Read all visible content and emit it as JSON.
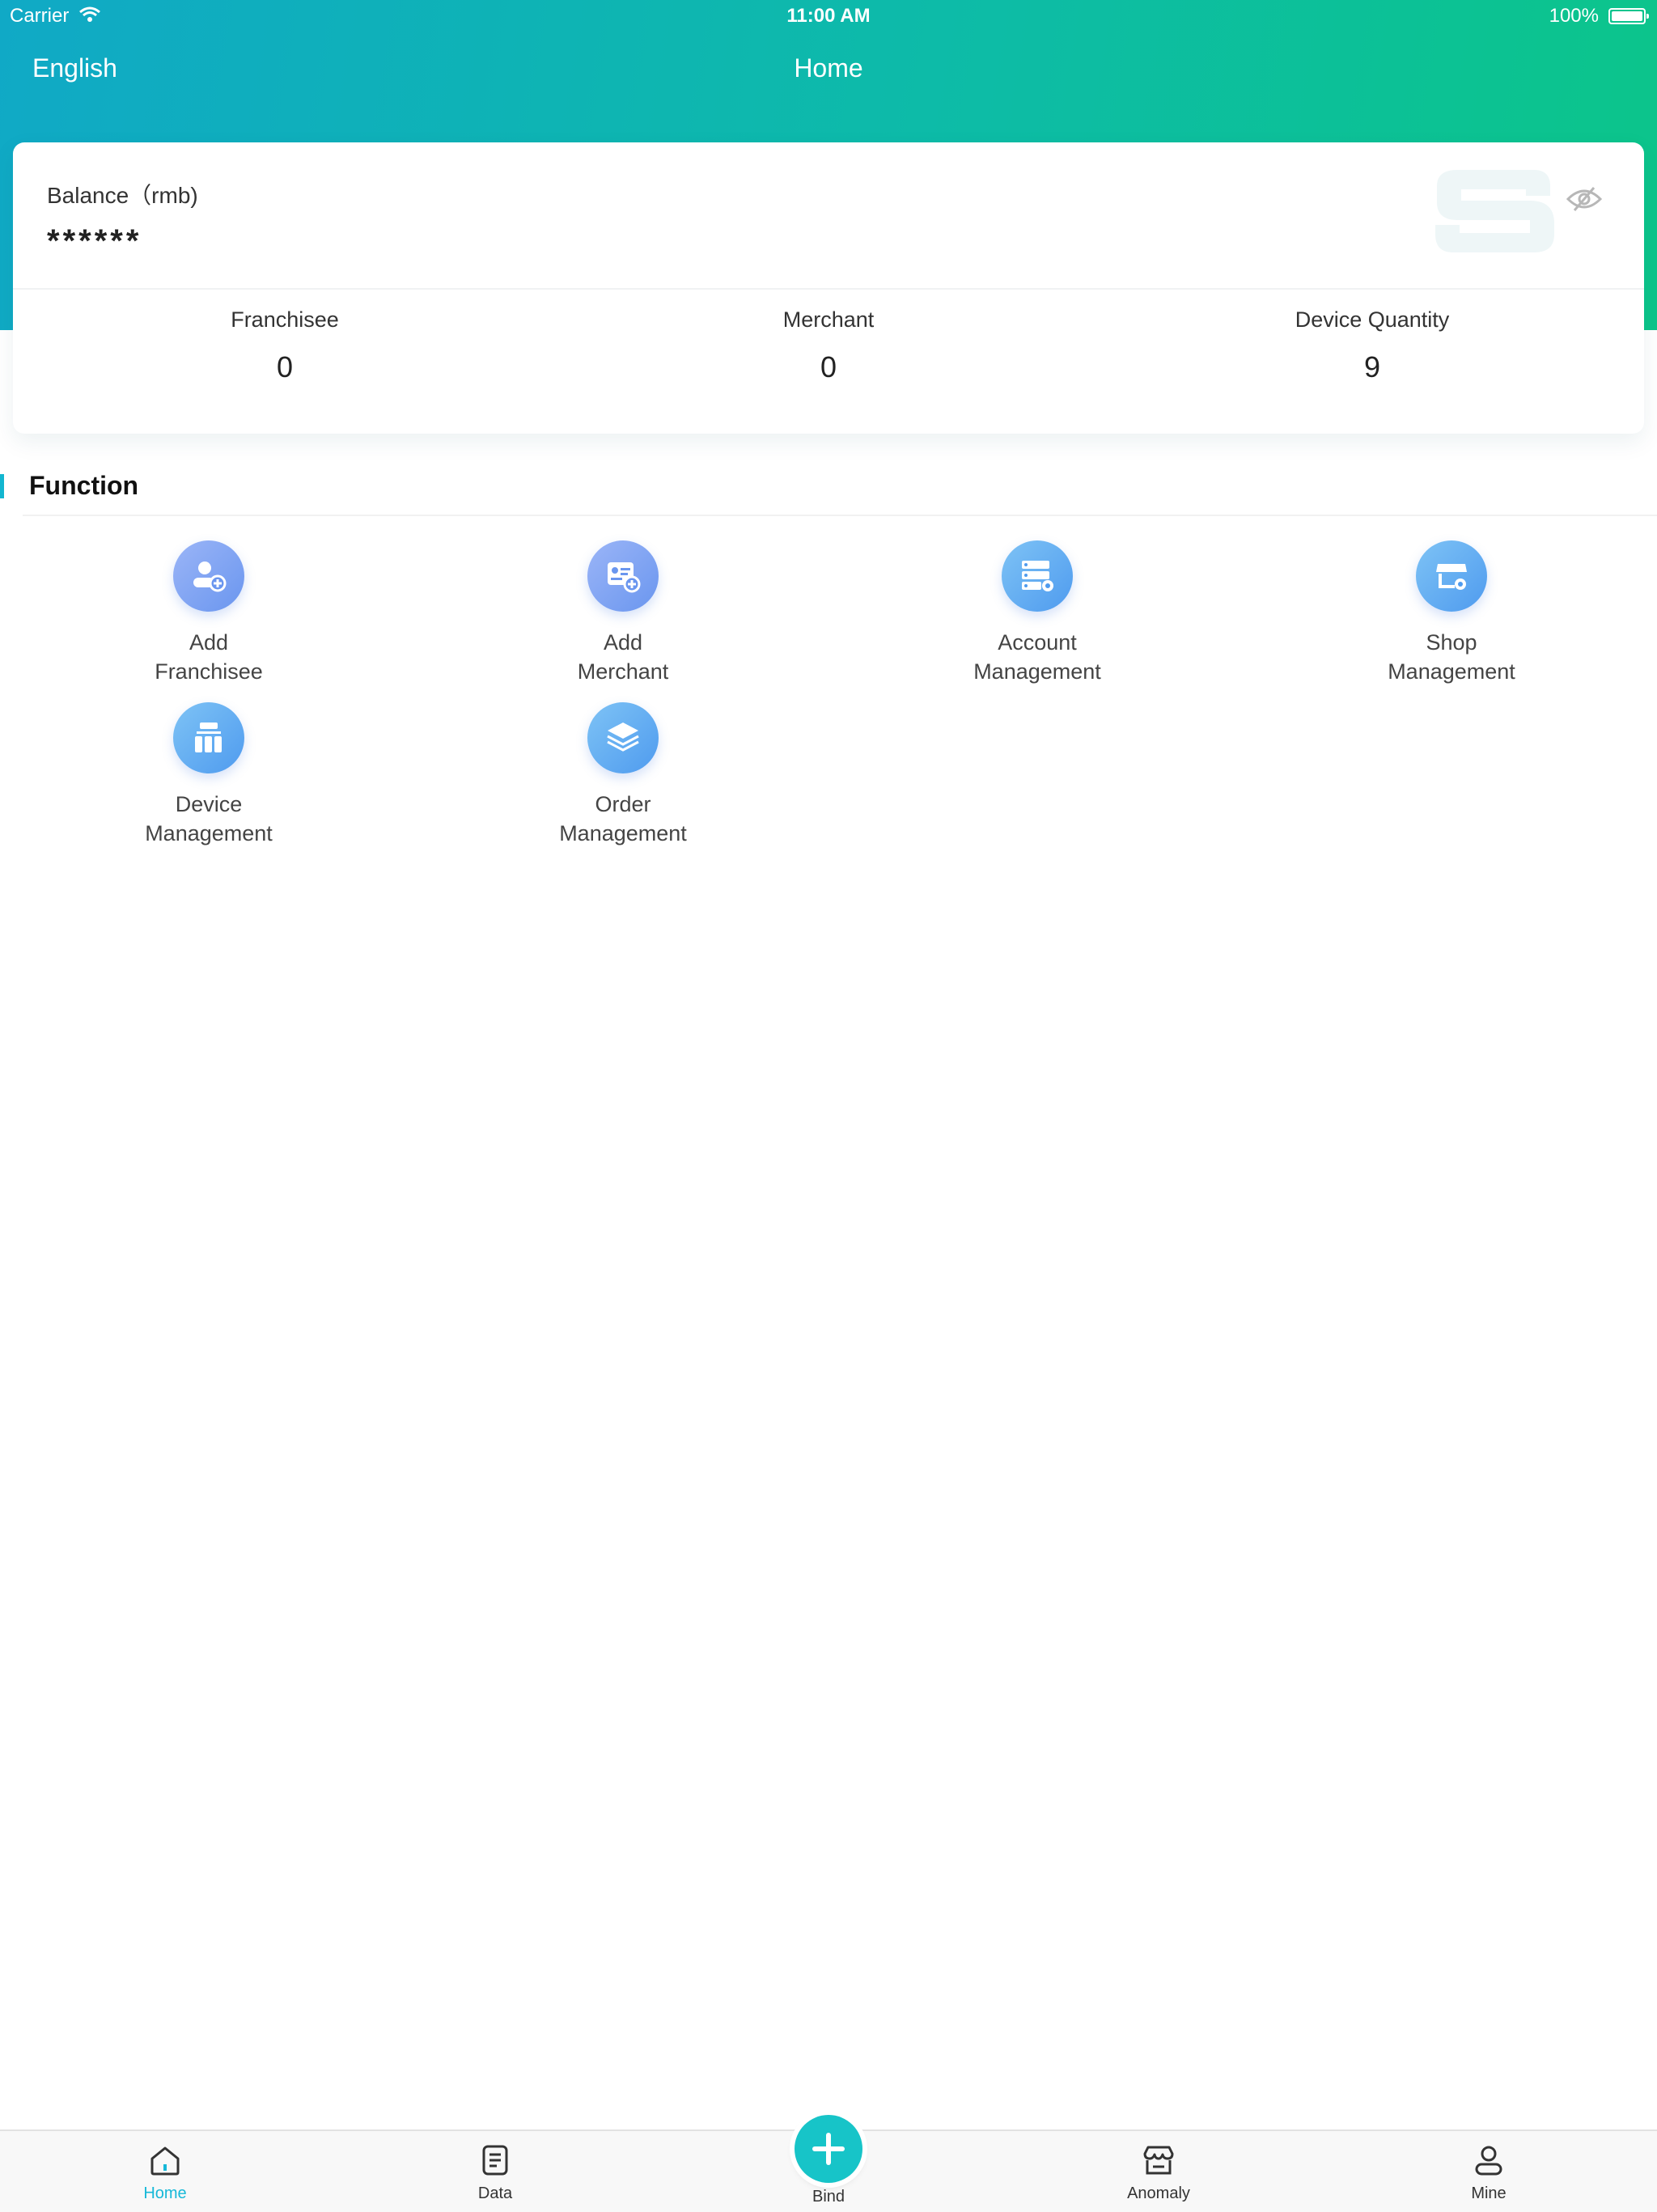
{
  "status_bar": {
    "carrier": "Carrier",
    "time": "11:00 AM",
    "battery": "100%"
  },
  "nav": {
    "language": "English",
    "title": "Home"
  },
  "balance": {
    "label": "Balance（rmb)",
    "value": "******"
  },
  "stats": [
    {
      "label": "Franchisee",
      "value": "0"
    },
    {
      "label": "Merchant",
      "value": "0"
    },
    {
      "label": "Device Quantity",
      "value": "9"
    }
  ],
  "section": {
    "title": "Function"
  },
  "functions": [
    {
      "line1": "Add",
      "line2": "Franchisee",
      "icon": "add-franchisee-icon"
    },
    {
      "line1": "Add",
      "line2": "Merchant",
      "icon": "add-merchant-icon"
    },
    {
      "line1": "Account",
      "line2": "Management",
      "icon": "account-management-icon"
    },
    {
      "line1": "Shop",
      "line2": "Management",
      "icon": "shop-management-icon"
    },
    {
      "line1": "Device",
      "line2": "Management",
      "icon": "device-management-icon"
    },
    {
      "line1": "Order",
      "line2": "Management",
      "icon": "order-management-icon"
    }
  ],
  "tabbar": {
    "home": "Home",
    "data": "Data",
    "bind": "Bind",
    "anomaly": "Anomaly",
    "mine": "Mine"
  },
  "colors": {
    "header_start": "#10a9c6",
    "header_end": "#0cc58a",
    "accent": "#16b8d8",
    "icon_gradient_start": "#7fa7f5",
    "icon_gradient_end": "#4f8ff0"
  }
}
